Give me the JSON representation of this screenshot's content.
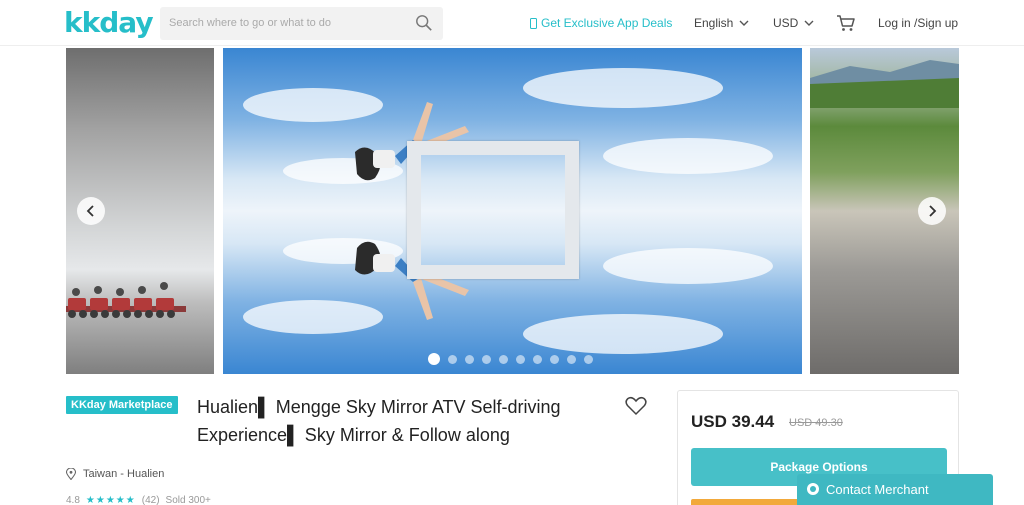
{
  "header": {
    "logo_text": "kkday",
    "search_placeholder": "Search where to go or what to do",
    "app_deals_label": "Get Exclusive App Deals",
    "language_label": "English",
    "currency_label": "USD",
    "login_label": "Log in /Sign up",
    "brand_color": "#26bec9"
  },
  "gallery": {
    "slide_count": 10,
    "active_slide": 1
  },
  "product": {
    "badge": "KKday Marketplace",
    "title": "Hualien▌ Mengge Sky Mirror ATV Self-driving Experience▌ Sky Mirror & Follow along",
    "location": "Taiwan - Hualien",
    "rating_value": "4.8",
    "stars": "★★★★★",
    "review_count": "(42)",
    "sold_label": "Sold 300+"
  },
  "pricing": {
    "price": "USD 39.44",
    "original_price": "USD 49.30",
    "package_button": "Package Options"
  },
  "contact": {
    "label": "Contact Merchant"
  }
}
